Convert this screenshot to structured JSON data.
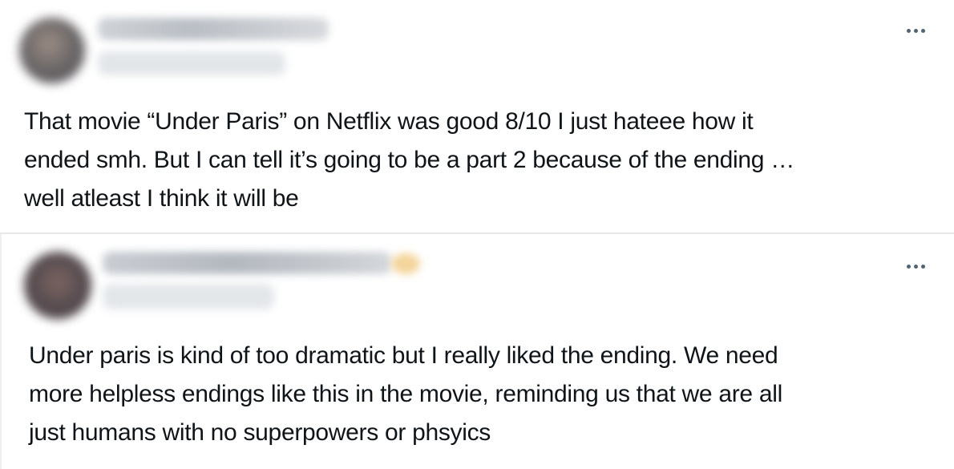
{
  "posts": [
    {
      "author_name": "",
      "author_handle": "",
      "more_icon": "more-horizontal-icon",
      "text": "That movie “Under Paris” on Netflix was good 8/10 I just hateee how it\nended smh. But I can tell it’s going to be a part 2 because of the ending …\nwell atleast I think it will be"
    },
    {
      "author_name": "",
      "author_handle": "",
      "more_icon": "more-horizontal-icon",
      "text": "Under paris is kind of too dramatic but I really liked the ending. We need\nmore helpless endings like this in the movie, reminding us that we are all\njust humans with no superpowers or phsyics"
    }
  ],
  "colors": {
    "text": "#0f1419",
    "secondary": "#536471",
    "divider": "#e7e9eb",
    "verified_badge": "#f3d49a"
  }
}
